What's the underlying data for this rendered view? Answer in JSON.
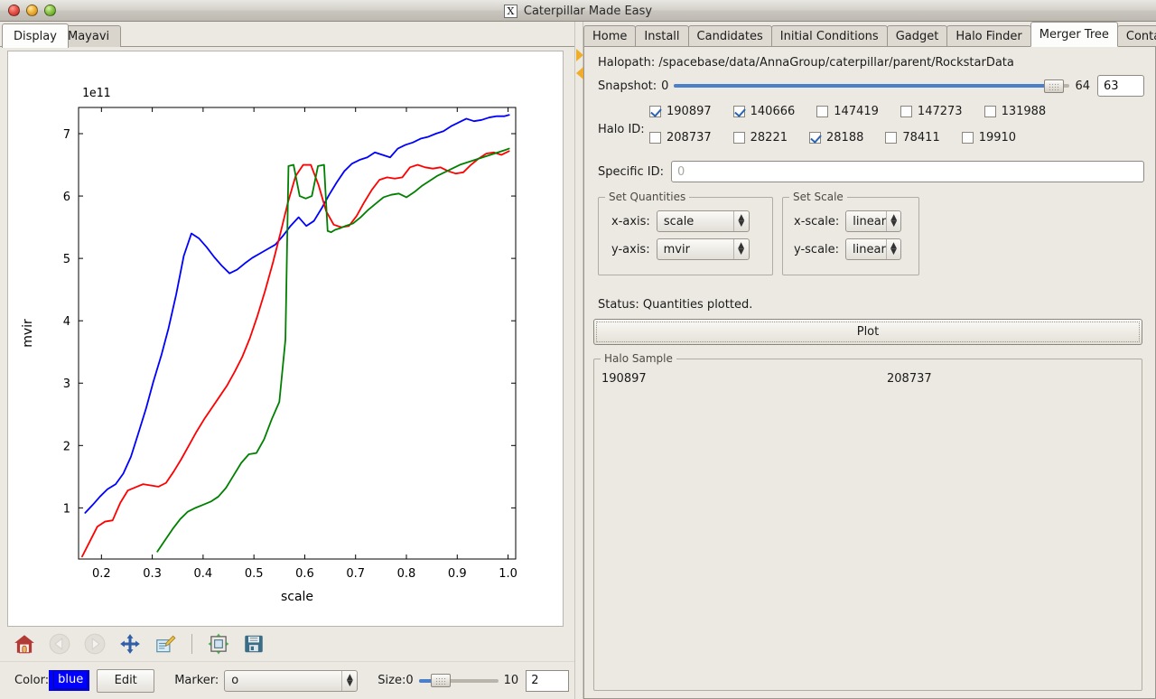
{
  "window": {
    "title": "Caterpillar Made Easy",
    "icon": "x-window-icon",
    "controls": [
      "close",
      "minimize",
      "maximize"
    ]
  },
  "left_pane": {
    "tabs": [
      {
        "label": "Display",
        "active": true
      },
      {
        "label": "Mayavi",
        "active": false
      }
    ],
    "toolbar": {
      "buttons": [
        {
          "name": "home-icon",
          "tooltip": "Reset original view",
          "enabled": true
        },
        {
          "name": "back-arrow-icon",
          "tooltip": "Back to previous view",
          "enabled": false
        },
        {
          "name": "forward-arrow-icon",
          "tooltip": "Forward to next view",
          "enabled": false
        },
        {
          "name": "pan-move-icon",
          "tooltip": "Pan axes with left mouse",
          "enabled": true
        },
        {
          "name": "zoom-rect-icon",
          "tooltip": "Zoom to rectangle",
          "enabled": true
        },
        {
          "name": "subplot-config-icon",
          "tooltip": "Configure subplots",
          "enabled": true
        },
        {
          "name": "save-floppy-icon",
          "tooltip": "Save the figure",
          "enabled": true
        }
      ]
    },
    "properties": {
      "color_label": "Color:",
      "color_value": "blue",
      "color_hex": "#0000ff",
      "edit_label": "Edit",
      "marker_label": "Marker:",
      "marker_value": "o",
      "size_label": "Size:",
      "size_min": "0",
      "size_max": "10",
      "size_value": "2"
    }
  },
  "right_pane": {
    "tabs": [
      {
        "label": "Home",
        "active": false
      },
      {
        "label": "Install",
        "active": false
      },
      {
        "label": "Candidates",
        "active": false
      },
      {
        "label": "Initial Conditions",
        "active": false
      },
      {
        "label": "Gadget",
        "active": false
      },
      {
        "label": "Halo Finder",
        "active": false
      },
      {
        "label": "Merger Tree",
        "active": true
      },
      {
        "label": "Contam.",
        "active": false
      }
    ],
    "halopath": {
      "label": "Halopath:",
      "value": "/spacebase/data/AnnaGroup/caterpillar/parent/RockstarData"
    },
    "snapshot": {
      "label": "Snapshot:",
      "min": "0",
      "max": "64",
      "value": "63",
      "fraction": 0.984
    },
    "halo_id": {
      "label": "Halo ID:",
      "row1": [
        {
          "id": "190897",
          "checked": true
        },
        {
          "id": "140666",
          "checked": true
        },
        {
          "id": "147419",
          "checked": false
        },
        {
          "id": "147273",
          "checked": false
        },
        {
          "id": "131988",
          "checked": false
        }
      ],
      "row2": [
        {
          "id": "208737",
          "checked": false
        },
        {
          "id": "28221",
          "checked": false
        },
        {
          "id": "28188",
          "checked": true
        },
        {
          "id": "78411",
          "checked": false
        },
        {
          "id": "19910",
          "checked": false
        }
      ]
    },
    "specific_id": {
      "label": "Specific ID:",
      "value": "",
      "placeholder": "0"
    },
    "set_quantities": {
      "title": "Set Quantities",
      "x_axis_label": "x-axis:",
      "x_axis_value": "scale",
      "y_axis_label": "y-axis:",
      "y_axis_value": "mvir"
    },
    "set_scale": {
      "title": "Set Scale",
      "x_scale_label": "x-scale:",
      "x_scale_value": "linear",
      "y_scale_label": "y-scale:",
      "y_scale_value": "linear"
    },
    "status": "Status: Quantities plotted.",
    "plot_button": "Plot",
    "halo_sample": {
      "title": "Halo Sample",
      "entries": [
        "190897",
        "208737"
      ]
    }
  },
  "chart_data": {
    "type": "line",
    "title": "",
    "xlabel": "scale",
    "ylabel": "mvir",
    "y_offset_text": "1e11",
    "y_multiplier": 100000000000.0,
    "xlim": [
      0.155,
      1.015
    ],
    "ylim": [
      0.18,
      7.42
    ],
    "xticks": [
      0.2,
      0.3,
      0.4,
      0.5,
      0.6,
      0.7,
      0.8,
      0.9,
      1.0
    ],
    "xtick_labels": [
      "0.2",
      "0.3",
      "0.4",
      "0.5",
      "0.6",
      "0.7",
      "0.8",
      "0.9",
      "1.0"
    ],
    "yticks": [
      1,
      2,
      3,
      4,
      5,
      6,
      7
    ],
    "ytick_labels": [
      "1",
      "2",
      "3",
      "4",
      "5",
      "6",
      "7"
    ],
    "grid": false,
    "legend": false,
    "marker": "o",
    "marker_size": 2,
    "series": [
      {
        "name": "190897",
        "color": "#0000ff",
        "x": [
          0.168,
          0.183,
          0.197,
          0.212,
          0.228,
          0.243,
          0.258,
          0.272,
          0.288,
          0.302,
          0.318,
          0.332,
          0.347,
          0.362,
          0.377,
          0.392,
          0.407,
          0.422,
          0.437,
          0.452,
          0.467,
          0.482,
          0.497,
          0.512,
          0.527,
          0.542,
          0.557,
          0.572,
          0.588,
          0.603,
          0.618,
          0.633,
          0.648,
          0.663,
          0.678,
          0.693,
          0.708,
          0.723,
          0.738,
          0.753,
          0.768,
          0.783,
          0.798,
          0.813,
          0.828,
          0.843,
          0.858,
          0.873,
          0.888,
          0.903,
          0.918,
          0.933,
          0.948,
          0.963,
          0.978,
          0.993,
          1.002
        ],
        "y": [
          0.92,
          1.05,
          1.18,
          1.3,
          1.38,
          1.55,
          1.82,
          2.18,
          2.6,
          3.02,
          3.45,
          3.88,
          4.42,
          5.04,
          5.4,
          5.32,
          5.18,
          5.02,
          4.88,
          4.76,
          4.82,
          4.92,
          5.01,
          5.08,
          5.15,
          5.22,
          5.36,
          5.52,
          5.66,
          5.52,
          5.6,
          5.8,
          6.02,
          6.22,
          6.4,
          6.52,
          6.58,
          6.62,
          6.7,
          6.66,
          6.62,
          6.76,
          6.82,
          6.86,
          6.92,
          6.95,
          7.0,
          7.04,
          7.12,
          7.18,
          7.24,
          7.2,
          7.22,
          7.26,
          7.28,
          7.28,
          7.3
        ]
      },
      {
        "name": "140666",
        "color": "#ff0000",
        "x": [
          0.162,
          0.177,
          0.192,
          0.207,
          0.222,
          0.237,
          0.252,
          0.267,
          0.282,
          0.297,
          0.312,
          0.327,
          0.342,
          0.357,
          0.372,
          0.387,
          0.402,
          0.417,
          0.432,
          0.447,
          0.462,
          0.477,
          0.492,
          0.507,
          0.522,
          0.537,
          0.552,
          0.567,
          0.582,
          0.597,
          0.612,
          0.627,
          0.642,
          0.657,
          0.672,
          0.687,
          0.702,
          0.717,
          0.732,
          0.747,
          0.762,
          0.777,
          0.792,
          0.807,
          0.822,
          0.837,
          0.852,
          0.867,
          0.882,
          0.897,
          0.912,
          0.927,
          0.942,
          0.957,
          0.972,
          0.987,
          1.002
        ],
        "y": [
          0.22,
          0.46,
          0.7,
          0.78,
          0.8,
          1.08,
          1.28,
          1.33,
          1.38,
          1.36,
          1.34,
          1.4,
          1.58,
          1.78,
          2.0,
          2.22,
          2.42,
          2.6,
          2.78,
          2.96,
          3.18,
          3.42,
          3.72,
          4.08,
          4.48,
          4.92,
          5.4,
          5.9,
          6.32,
          6.5,
          6.5,
          6.18,
          5.76,
          5.54,
          5.5,
          5.52,
          5.68,
          5.9,
          6.1,
          6.26,
          6.3,
          6.28,
          6.3,
          6.46,
          6.5,
          6.46,
          6.44,
          6.46,
          6.4,
          6.36,
          6.38,
          6.5,
          6.6,
          6.68,
          6.7,
          6.66,
          6.72
        ]
      },
      {
        "name": "28188",
        "color": "#008000",
        "x": [
          0.31,
          0.325,
          0.34,
          0.355,
          0.37,
          0.385,
          0.4,
          0.415,
          0.43,
          0.445,
          0.46,
          0.475,
          0.49,
          0.505,
          0.52,
          0.535,
          0.55,
          0.562,
          0.568,
          0.578,
          0.59,
          0.602,
          0.614,
          0.626,
          0.638,
          0.645,
          0.652,
          0.66,
          0.668,
          0.68,
          0.695,
          0.71,
          0.725,
          0.74,
          0.755,
          0.77,
          0.785,
          0.8,
          0.815,
          0.83,
          0.845,
          0.86,
          0.875,
          0.89,
          0.905,
          0.92,
          0.935,
          0.95,
          0.965,
          0.98,
          0.995,
          1.002
        ],
        "y": [
          0.3,
          0.48,
          0.66,
          0.82,
          0.94,
          1.0,
          1.05,
          1.1,
          1.18,
          1.32,
          1.52,
          1.72,
          1.86,
          1.88,
          2.1,
          2.42,
          2.7,
          3.7,
          6.48,
          6.5,
          6.0,
          5.96,
          6.0,
          6.48,
          6.5,
          5.44,
          5.42,
          5.46,
          5.48,
          5.52,
          5.56,
          5.66,
          5.78,
          5.88,
          5.98,
          6.02,
          6.04,
          5.98,
          6.06,
          6.16,
          6.24,
          6.32,
          6.38,
          6.44,
          6.5,
          6.54,
          6.58,
          6.62,
          6.66,
          6.7,
          6.74,
          6.76
        ]
      }
    ]
  }
}
